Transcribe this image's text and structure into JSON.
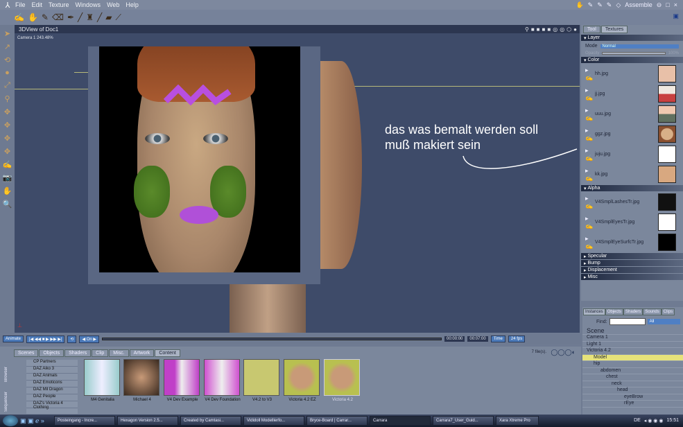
{
  "menu": [
    "File",
    "Edit",
    "Texture",
    "Windows",
    "Web",
    "Help"
  ],
  "rooms": {
    "label": "Assemble"
  },
  "viewport": {
    "title": "3DView of Doc1",
    "camera": "Camera 1 243.48%"
  },
  "annotation": {
    "line1": "das was bemalt werden soll",
    "line2": "muß makiert sein"
  },
  "texture_panel": {
    "tabs": [
      "Tool",
      "Textures"
    ],
    "layer_header": "Layer",
    "mode_label": "Mode",
    "mode_value": "Normal",
    "opacity_label": "Opacity",
    "opacity_value": "100%",
    "color_header": "Color",
    "color_items": [
      "hh.jpg",
      "jj.jpg",
      "uuu.jpg",
      "ggz.jpg",
      "juju.jpg",
      "kk.jpg"
    ],
    "alpha_header": "Alpha",
    "alpha_items": [
      "V4SmplLashesTr.jpg",
      "V4SmplEyesTr.jpg",
      "V4SmplEyeSurfcTr.jpg"
    ],
    "other_headers": [
      "Specular",
      "Bump",
      "Displacement",
      "Misc"
    ]
  },
  "scene_panel": {
    "tabs": [
      "Instances",
      "Objects",
      "Shaders",
      "Sounds",
      "Clips"
    ],
    "find_label": "Find:",
    "filter_value": "All",
    "tree": [
      "Scene",
      "Camera 1",
      "Light 1",
      "Victoria 4.2",
      "Model",
      "hip",
      "abdomen",
      "chest",
      "neck",
      "head",
      "eyeBrow",
      "rEye"
    ]
  },
  "anim": {
    "animate": "Animate",
    "time_start": "00:00:00",
    "time_end": "00:07:00",
    "mode": "Time",
    "fps": "24 fps"
  },
  "browser": {
    "side_tabs": [
      "Sequencer",
      "Browser"
    ],
    "tabs": [
      "Scenes",
      "Objects",
      "Shaders",
      "Clip",
      "Misc.",
      "Artwork",
      "Content"
    ],
    "file_count": "7 file(s).",
    "categories": [
      "CP Partners",
      "DAZ Aiko 3",
      "DAZ Animals",
      "DAZ Emoticons",
      "DAZ Mil Dragon",
      "DAZ People",
      "DAZ's Victoria 4 Clothing"
    ],
    "items": [
      "M4 Genitalia",
      "Michael 4",
      "V4 Dev Example",
      "V4 Dev Foundation",
      "V4.2 to V3",
      "Victoria 4.2 EZ",
      "Victoria 4.2"
    ]
  },
  "taskbar": {
    "tasks": [
      "Posteingang - Incre...",
      "Hexagon Version 2.5...",
      "Created by Camtasi...",
      "Vididoll Modellierfo...",
      "Bryce-Board | Carrar...",
      "Carrara",
      "Carrara7_User_Guid...",
      "Xara Xtreme Pro"
    ],
    "lang": "DE",
    "clock": "15:51"
  }
}
